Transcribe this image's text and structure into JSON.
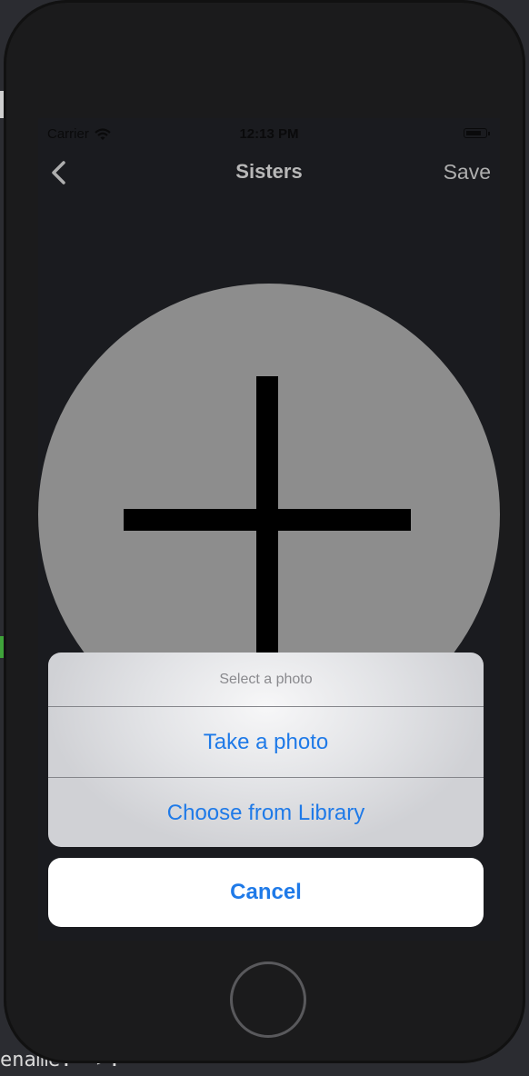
{
  "status_bar": {
    "carrier": "Carrier",
    "time": "12:13 PM",
    "wifi_icon": "wifi-icon",
    "battery_icon": "battery-icon"
  },
  "nav": {
    "back_icon": "chevron-left-icon",
    "title": "Sisters",
    "save_label": "Save"
  },
  "photo_placeholder": {
    "icon": "plus-icon"
  },
  "action_sheet": {
    "title": "Select a photo",
    "options": [
      "Take a photo",
      "Choose from Library"
    ],
    "cancel_label": "Cancel",
    "accent_color": "#1f7ae8"
  },
  "background_code": "ename: =>."
}
